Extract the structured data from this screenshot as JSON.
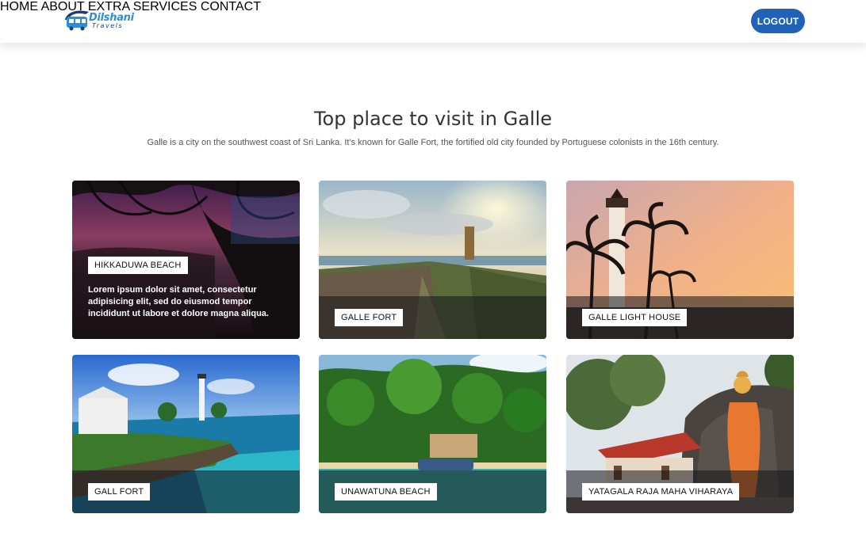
{
  "brand": {
    "name": "Dilshani",
    "tagline": "Travels"
  },
  "nav": {
    "items": [
      "HOME",
      "ABOUT",
      "EXTRA SERVICES",
      "CONTACT"
    ],
    "logout": "LOGOUT"
  },
  "intro": {
    "title": "Top place to visit in Galle",
    "subtitle": "Galle is a city on the southwest coast of Sri Lanka. It's known for Galle Fort, the fortified old city founded by Portuguese colonists in the 16th century."
  },
  "places": [
    {
      "label": "HIKKADUWA BEACH",
      "description": "Lorem ipsum dolor sit amet, consectetur adipisicing elit, sed do eiusmod tempor incididunt ut labore et dolore magna aliqua."
    },
    {
      "label": "GALLE FORT"
    },
    {
      "label": "GALLE LIGHT HOUSE"
    },
    {
      "label": "GALL FORT"
    },
    {
      "label": "UNAWATUNA BEACH"
    },
    {
      "label": "YATAGALA RAJA MAHA VIHARAYA"
    }
  ],
  "colors": {
    "brand_blue": "#1f62b8",
    "nav_text": "#2a5fa8"
  }
}
